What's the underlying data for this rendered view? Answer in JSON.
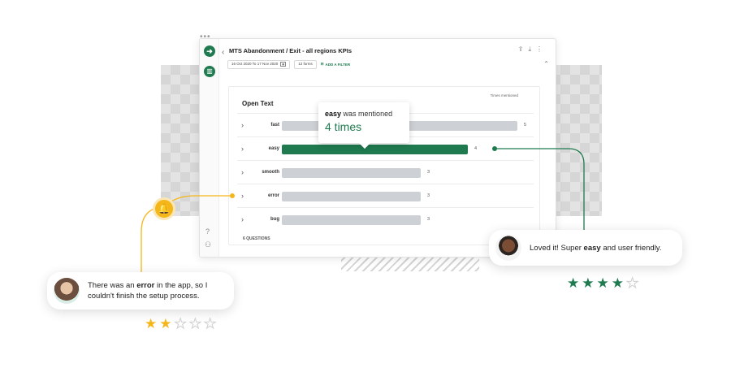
{
  "window": {
    "title": "MTS Abandonment / Exit - all regions KPIs",
    "date_range": "16 Oct 2020 To 17 Nov 2020",
    "forms": "12 forms",
    "add_filter": "ADD A FILTER"
  },
  "card": {
    "title": "Open Text",
    "times_label": "Times mentioned",
    "footer": "6 QUESTIONS",
    "rows": [
      {
        "label": "fast",
        "count": "5",
        "value": 5
      },
      {
        "label": "easy",
        "count": "4",
        "value": 4
      },
      {
        "label": "smooth",
        "count": "3",
        "value": 3
      },
      {
        "label": "error",
        "count": "3",
        "value": 3
      },
      {
        "label": "bug",
        "count": "3",
        "value": 3
      }
    ]
  },
  "tooltip": {
    "keyword": "easy",
    "suffix": "was mentioned",
    "amount": "4 times"
  },
  "review_left": {
    "text_before": "There was an ",
    "emphasis": "error",
    "text_after": " in the app, so I couldn't finish the setup process.",
    "rating": 2,
    "max": 5
  },
  "review_right": {
    "text_before": "Loved it! Super ",
    "emphasis": "easy",
    "text_after": " and user friendly.",
    "rating": 4,
    "max": 5
  },
  "colors": {
    "brand_green": "#1f7a4f",
    "accent_yellow": "#f5b619",
    "bar_gray": "#cdd0d4"
  },
  "icons": [
    "logo-icon",
    "chart-icon",
    "help-icon",
    "users-icon",
    "bell-icon",
    "star-icon",
    "chevron-right-icon",
    "calendar-icon",
    "share-icon",
    "download-icon",
    "more-icon"
  ]
}
